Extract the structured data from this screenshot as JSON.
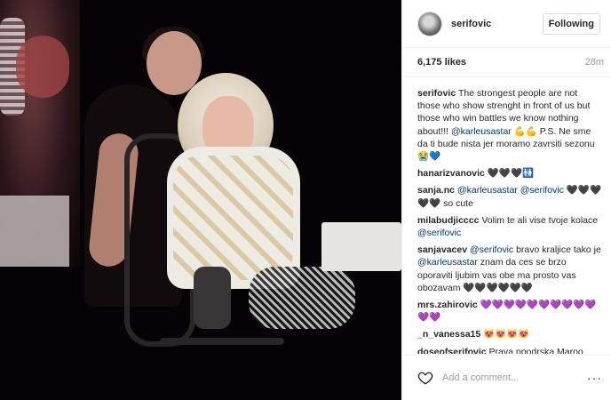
{
  "post": {
    "username": "serifovic",
    "follow_label": "Following",
    "likes": "6,175 likes",
    "time": "28m",
    "add_comment_placeholder": "Add a comment...",
    "more_glyph": "···"
  },
  "caption": {
    "username": "serifovic",
    "text": "The strongest people are not those who show strenght in front of us but those who win battles we know nothing about!!! @karleusastar 💪💪 P.S. Ne sme da ti bude nista jer moramo zavrsiti sezonu😭💙"
  },
  "comments": [
    {
      "username": "hanarizvanovic",
      "text": "🖤🖤🖤🚻"
    },
    {
      "username": "sanja.nc",
      "text": "@karleusastar @serifovic 🖤🖤🖤🖤🖤 so cute"
    },
    {
      "username": "milabudjicccc",
      "text": "Volim te ali vise tvoje kolace @serifovic"
    },
    {
      "username": "sanjavacev",
      "text": "@serifovic bravo kraljice tako je @karleusastar znam da ces se brzo oporaviti ljubim vas obe ma prosto vas obozavam 🖤🖤🖤🖤🖤🖤"
    },
    {
      "username": "mrs.zahirovic",
      "text": "💜💜💜💜💜💜💜💜💜💜💜💜"
    },
    {
      "username": "_n_vanessa15",
      "text": "😻😻😻😻"
    },
    {
      "username": "doseofserifovic",
      "text": "Prava ppodrska Maroo"
    }
  ],
  "icons": {
    "heart": "heart-outline-icon",
    "avatar": "profile-avatar"
  }
}
